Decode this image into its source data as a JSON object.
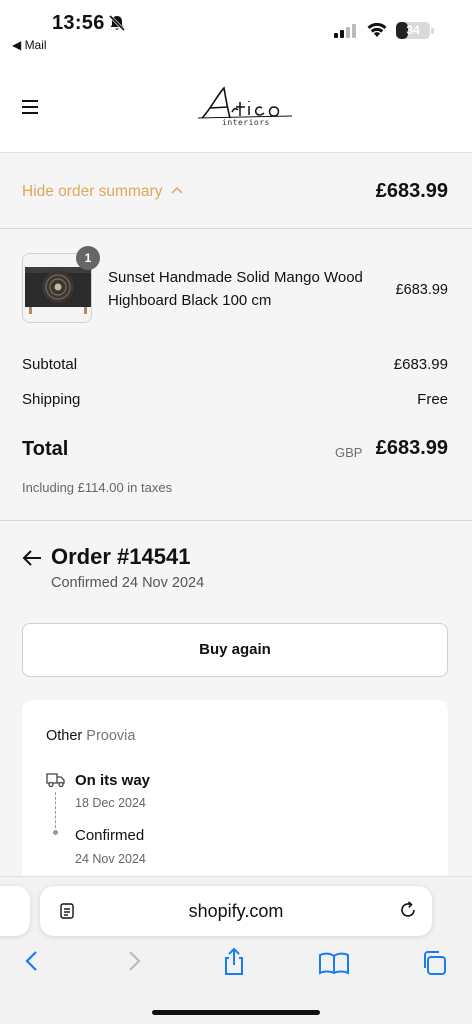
{
  "status_bar": {
    "time": "13:56",
    "back_app": "◀ Mail",
    "battery_level": "34",
    "battery_fraction": 0.34
  },
  "header": {
    "logo_text": "Artico",
    "logo_subtext": "interiors",
    "menu_icon": "hamburger-icon"
  },
  "summary": {
    "toggle_label": "Hide order summary",
    "total": "£683.99"
  },
  "line_item": {
    "quantity": "1",
    "name": "Sunset Handmade Solid Mango Wood Highboard Black 100 cm",
    "price": "£683.99"
  },
  "totals": {
    "subtotal_label": "Subtotal",
    "subtotal_value": "£683.99",
    "shipping_label": "Shipping",
    "shipping_value": "Free",
    "total_label": "Total",
    "currency": "GBP",
    "total_value": "£683.99",
    "taxes_note": "Including £114.00 in taxes"
  },
  "order": {
    "title": "Order #14541",
    "confirmed": "Confirmed 24 Nov 2024",
    "buy_again_label": "Buy again",
    "carrier_prefix": "Other",
    "carrier_name": "Proovia",
    "steps": [
      {
        "label": "On its way",
        "date": "18 Dec 2024"
      },
      {
        "label": "Confirmed",
        "date": "24 Nov 2024"
      }
    ]
  },
  "browser": {
    "url": "shopify.com"
  },
  "colors": {
    "accent": "#e0a65a",
    "text": "#111111",
    "muted": "#707070",
    "safari_blue": "#1a7cf2"
  }
}
